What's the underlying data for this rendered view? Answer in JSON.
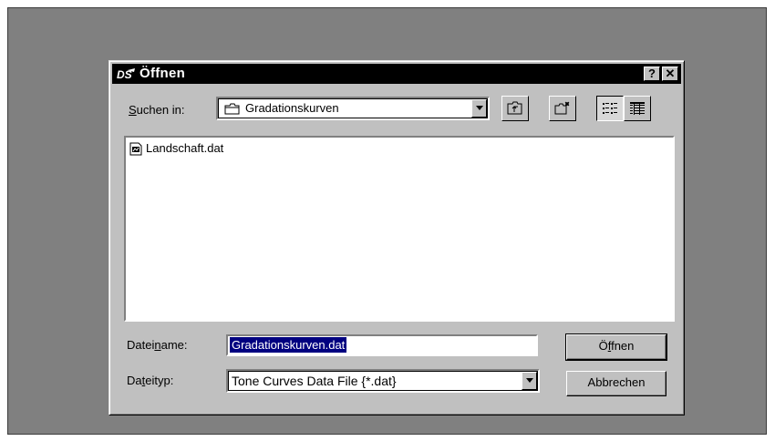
{
  "dialog": {
    "title": "Öffnen",
    "app_icon": "ds-app-icon",
    "help_button": "?",
    "close_button": "✕"
  },
  "lookin": {
    "label_pre": "",
    "label_u": "S",
    "label_post": "uchen in:",
    "folder": "Gradationskurven",
    "folder_icon": "folder-icon"
  },
  "toolbar": {
    "buttons": [
      "up-one-level-icon",
      "new-folder-icon",
      "list-view-icon",
      "details-view-icon"
    ]
  },
  "files": [
    {
      "name": "Landschaft.dat",
      "icon": "data-file-icon"
    }
  ],
  "filename": {
    "label_pre": "Datei",
    "label_u": "n",
    "label_post": "ame:",
    "value": "Gradationskurven.dat"
  },
  "filetype": {
    "label_pre": "Da",
    "label_u": "t",
    "label_post": "eityp:",
    "value": "Tone Curves Data File {*.dat}"
  },
  "buttons": {
    "open_pre": "Ö",
    "open_u": "f",
    "open_post": "fnen",
    "cancel": "Abbrechen"
  }
}
